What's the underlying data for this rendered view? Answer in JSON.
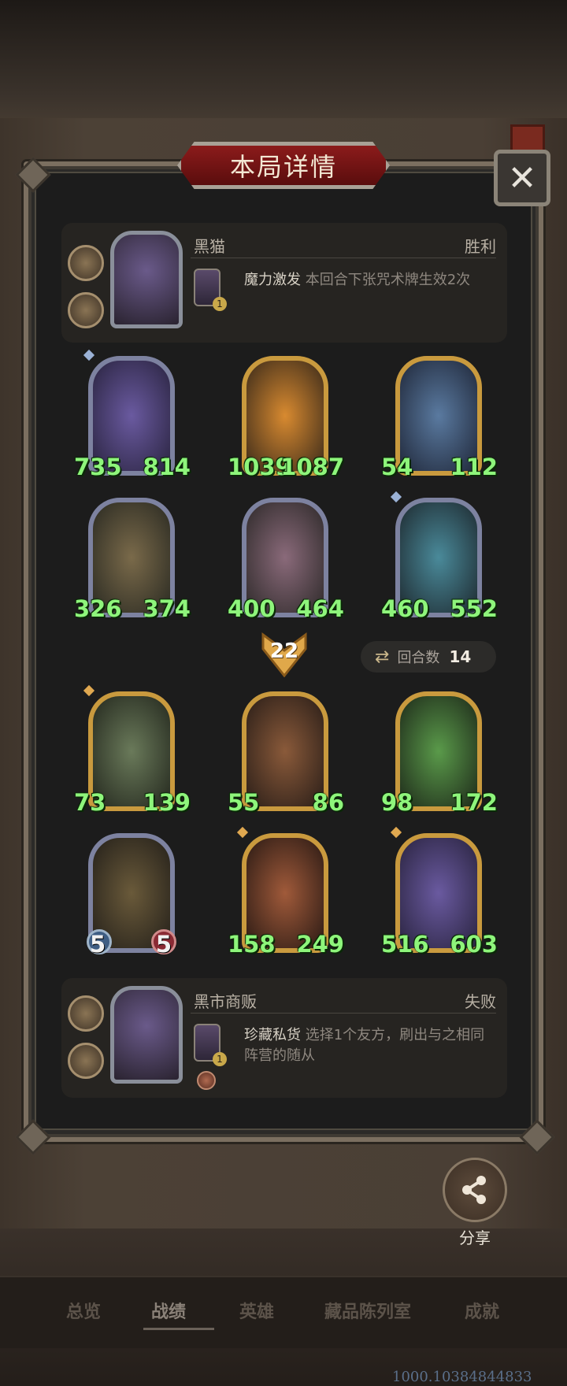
{
  "title": "本局详情",
  "close_icon": "close-icon",
  "player_top": {
    "name": "黑猫",
    "result": "胜利",
    "spell_name": "魔力激发",
    "spell_desc": "本回合下张咒术牌生效2次",
    "card_cost": "1"
  },
  "player_bottom": {
    "name": "黑市商贩",
    "result": "失败",
    "spell_name": "珍藏私货",
    "spell_desc": "选择1个友方，刷出与之相同阵营的随从",
    "card_cost": "1"
  },
  "top_board": [
    {
      "atk": "735",
      "hp": "814"
    },
    {
      "atk": "1039",
      "hp": "1087"
    },
    {
      "atk": "54",
      "hp": "112"
    },
    {
      "atk": "326",
      "hp": "374"
    },
    {
      "atk": "400",
      "hp": "464"
    },
    {
      "atk": "460",
      "hp": "552"
    }
  ],
  "damage": "22",
  "round_label": "回合数",
  "round_value": "14",
  "bottom_board": [
    {
      "atk": "73",
      "hp": "139"
    },
    {
      "atk": "55",
      "hp": "86"
    },
    {
      "atk": "98",
      "hp": "172"
    },
    {
      "atk": "5",
      "hp": "5"
    },
    {
      "atk": "158",
      "hp": "249"
    },
    {
      "atk": "516",
      "hp": "603"
    }
  ],
  "share_label": "分享",
  "nav": [
    "总览",
    "战绩",
    "英雄",
    "藏品陈列室",
    "成就"
  ],
  "version": "1000.10384844833"
}
